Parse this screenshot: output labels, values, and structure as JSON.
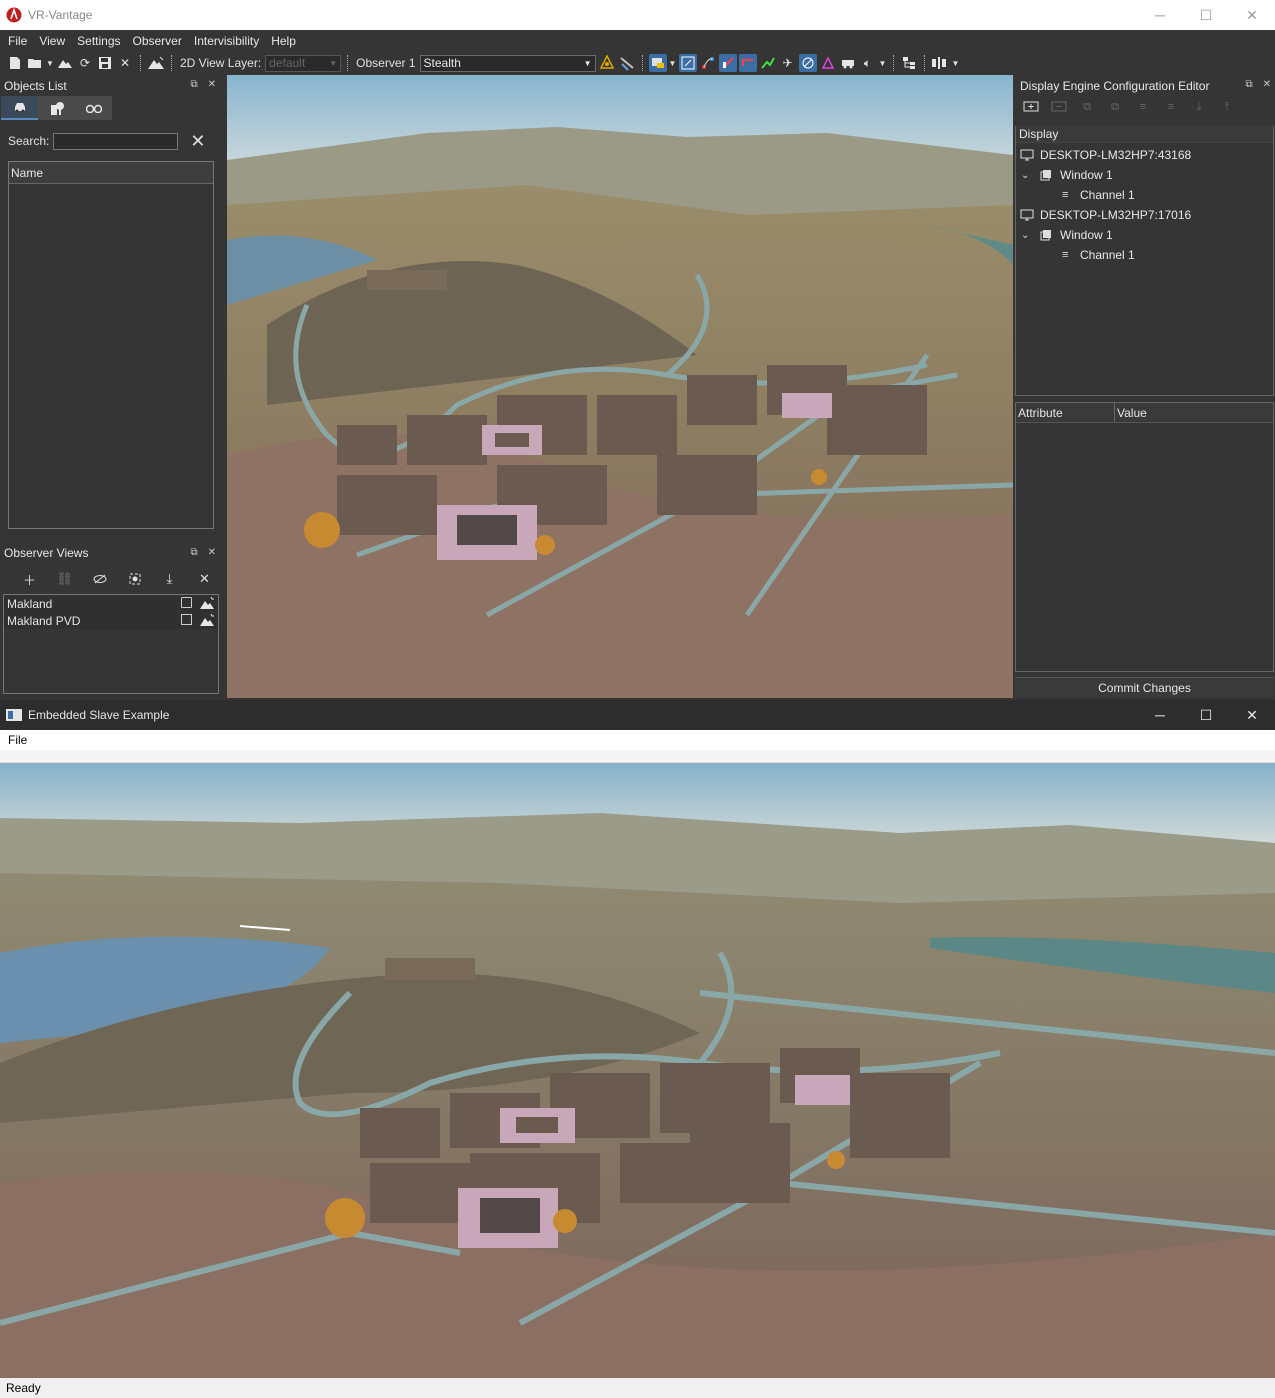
{
  "main_window": {
    "title": "VR-Vantage",
    "controls": {
      "minimize": "─",
      "maximize": "☐",
      "close": "✕"
    }
  },
  "menu": [
    "File",
    "View",
    "Settings",
    "Observer",
    "Intervisibility",
    "Help"
  ],
  "toolbar": {
    "layer_label": "2D View Layer:",
    "layer_value": "default",
    "observer_label": "Observer 1",
    "observer_mode": "Stealth"
  },
  "objects_panel": {
    "title": "Objects List",
    "search_label": "Search:",
    "search_value": "",
    "column_header": "Name",
    "tabs": [
      "car-icon",
      "trees-icon",
      "binoculars-icon"
    ]
  },
  "observer_views": {
    "title": "Observer Views",
    "items": [
      {
        "label": "Makland"
      },
      {
        "label": "Makland PVD"
      }
    ]
  },
  "config_editor": {
    "title": "Display Engine Configuration Editor",
    "tree_header": "Display",
    "tree": [
      {
        "host": "DESKTOP-LM32HP7:43168",
        "window": "Window 1",
        "channel": "Channel 1"
      },
      {
        "host": "DESKTOP-LM32HP7:17016",
        "window": "Window 1",
        "channel": "Channel 1"
      }
    ],
    "attr_col": "Attribute",
    "value_col": "Value",
    "commit_label": "Commit Changes"
  },
  "slave_window": {
    "title": "Embedded Slave Example",
    "menu": [
      "File"
    ],
    "status": "Ready"
  },
  "colors": {
    "dark_bg": "#353535",
    "accent_blue": "#3a6ea5",
    "sky": "#a9c9d8",
    "terrain": "#8a7458"
  }
}
